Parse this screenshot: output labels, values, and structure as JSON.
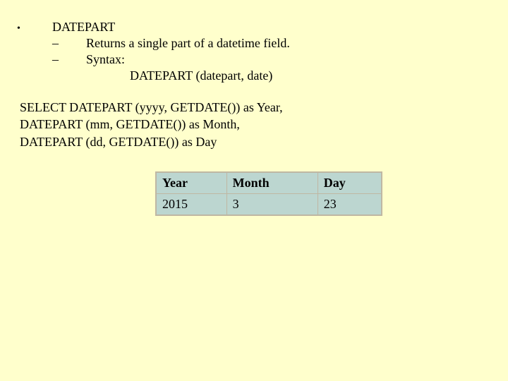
{
  "bullets": {
    "l1_marker": "•",
    "l1_text": "DATEPART",
    "l2_marker": "–",
    "l2a_text": "Returns a single part of a datetime field.",
    "l2b_text": "Syntax:",
    "l3_text": "DATEPART (datepart, date)"
  },
  "code": {
    "line1": "SELECT DATEPART (yyyy, GETDATE()) as Year,",
    "line2": "DATEPART (mm, GETDATE()) as Month,",
    "line3": "DATEPART (dd, GETDATE()) as Day"
  },
  "table": {
    "headers": {
      "c0": "Year",
      "c1": "Month",
      "c2": "Day"
    },
    "row0": {
      "c0": "2015",
      "c1": "3",
      "c2": "23"
    }
  },
  "chart_data": {
    "type": "table",
    "columns": [
      "Year",
      "Month",
      "Day"
    ],
    "rows": [
      [
        "2015",
        "3",
        "23"
      ]
    ]
  }
}
